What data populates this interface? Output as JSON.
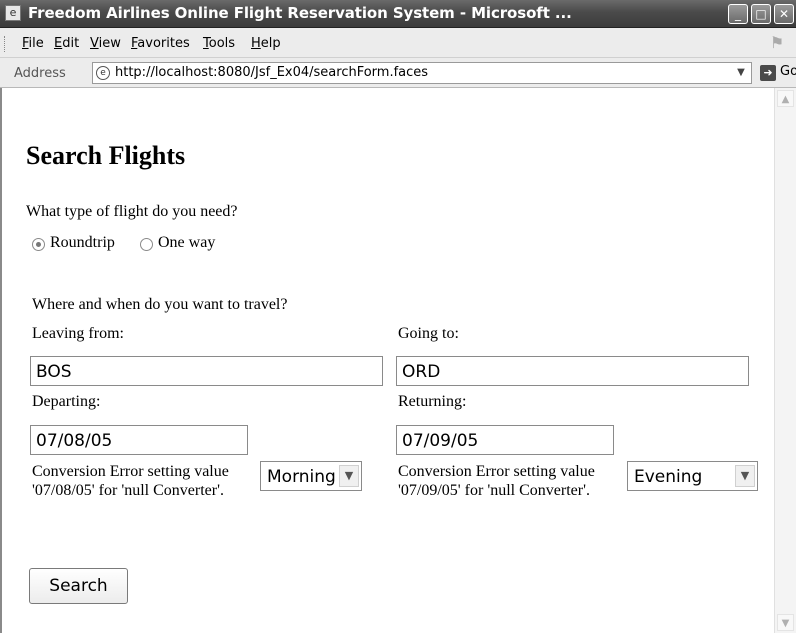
{
  "window": {
    "title": "Freedom Airlines Online Flight Reservation System - Microsoft ...",
    "app_icon": "ie-page-icon"
  },
  "menu": {
    "items": [
      "File",
      "Edit",
      "View",
      "Favorites",
      "Tools",
      "Help"
    ]
  },
  "address": {
    "label": "Address",
    "url": "http://localhost:8080/Jsf_Ex04/searchForm.faces",
    "go_label": "Go"
  },
  "page": {
    "title": "Search Flights",
    "flight_type": {
      "question": "What type of flight do you need?",
      "options": [
        {
          "label": "Roundtrip",
          "checked": true
        },
        {
          "label": "One way",
          "checked": false
        }
      ]
    },
    "travel_question": "Where and when do you want to travel?",
    "leaving": {
      "label": "Leaving from:",
      "value": "BOS"
    },
    "going": {
      "label": "Going to:",
      "value": "ORD"
    },
    "departing": {
      "label": "Departing:",
      "value": "07/08/05",
      "error": "Conversion Error setting value '07/08/05' for 'null Converter'.",
      "time": "Morning"
    },
    "returning": {
      "label": "Returning:",
      "value": "07/09/05",
      "error": "Conversion Error setting value '07/09/05' for 'null Converter'.",
      "time": "Evening"
    },
    "search_button": "Search"
  }
}
